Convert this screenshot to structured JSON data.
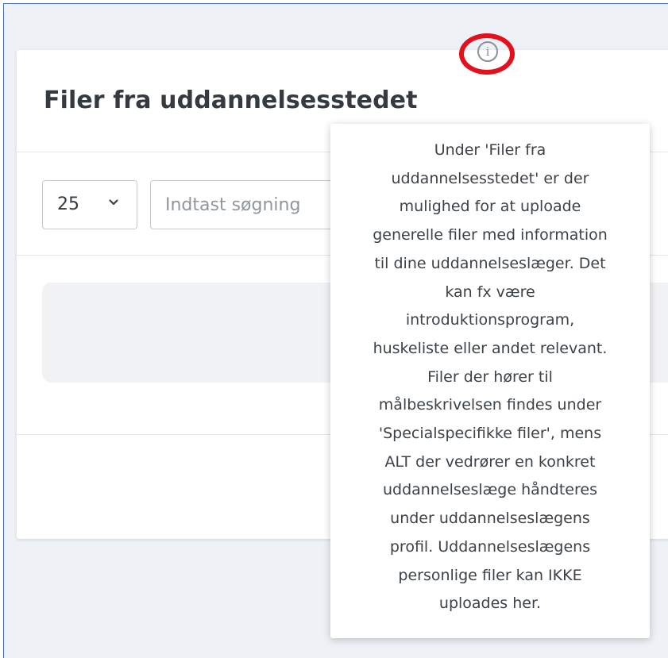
{
  "card": {
    "title": "Filer fra uddannelsesstedet"
  },
  "controls": {
    "page_size": "25",
    "search_placeholder": "Indtast søgning"
  },
  "tooltip": {
    "lines": [
      "Under 'Filer fra",
      "uddannelsesstedet' er der",
      "mulighed for at uploade",
      "generelle filer med information",
      "til dine uddannelseslæger. Det",
      "kan fx være",
      "introduktionsprogram,",
      "huskeliste eller andet relevant.",
      "Filer der hører til",
      "målbeskrivelsen findes under",
      "'Specialspecifikke filer', mens",
      "ALT der vedrører en konkret",
      "uddannelseslæge håndteres",
      "under uddannelseslægens",
      "profil. Uddannelseslægens",
      "personlige filer kan IKKE",
      "uploades her."
    ]
  },
  "icons": {
    "info_glyph": "i",
    "info_icon_color": "#8a9198",
    "highlight_color": "#e4101c"
  }
}
